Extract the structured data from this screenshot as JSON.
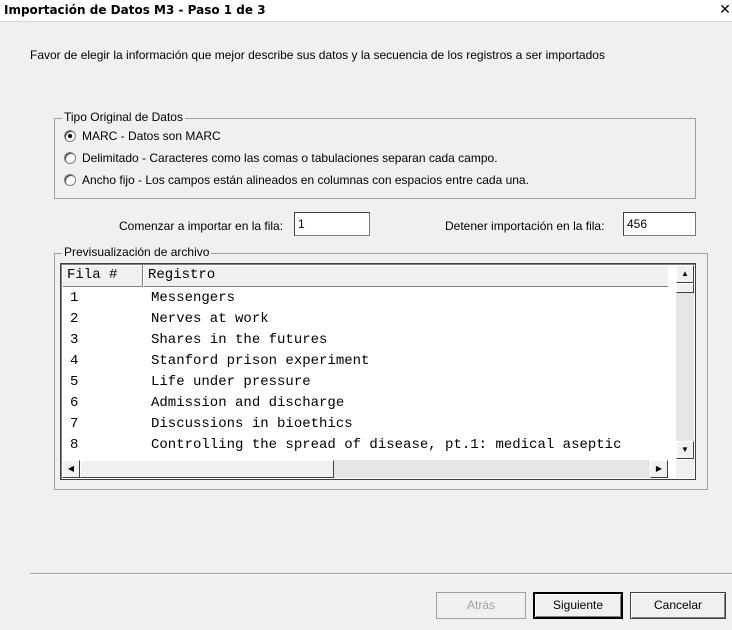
{
  "window": {
    "title": "Importación de Datos M3 - Paso 1 de 3",
    "close_glyph": "✕"
  },
  "instructions": "Favor de elegir la información que mejor describe sus datos y la secuencia de los registros a ser importados",
  "data_type": {
    "legend": "Tipo Original de Datos",
    "options": [
      {
        "label": "MARC - Datos son MARC",
        "checked": true
      },
      {
        "label": "Delimitado - Caracteres como las comas o tabulaciones separan cada campo.",
        "checked": false
      },
      {
        "label": "Ancho fijo - Los campos están alineados en columnas con espacios entre cada una.",
        "checked": false
      }
    ]
  },
  "range": {
    "start_label": "Comenzar a importar en la fila:",
    "start_value": "1",
    "stop_label": "Detener importación en la fila:",
    "stop_value": "456"
  },
  "preview": {
    "legend": "Previsualización de archivo",
    "columns": [
      "Fila #",
      "Registro"
    ],
    "rows": [
      [
        "1",
        "Messengers"
      ],
      [
        "2",
        "Nerves at work"
      ],
      [
        "3",
        "Shares in the futures"
      ],
      [
        "4",
        "Stanford prison experiment"
      ],
      [
        "5",
        "Life under pressure"
      ],
      [
        "6",
        "Admission and discharge"
      ],
      [
        "7",
        "Discussions in bioethics"
      ],
      [
        "8",
        "Controlling the spread of disease, pt.1: medical aseptic"
      ]
    ]
  },
  "buttons": {
    "back": "Atrás",
    "next": "Siguiente",
    "cancel": "Cancelar"
  }
}
